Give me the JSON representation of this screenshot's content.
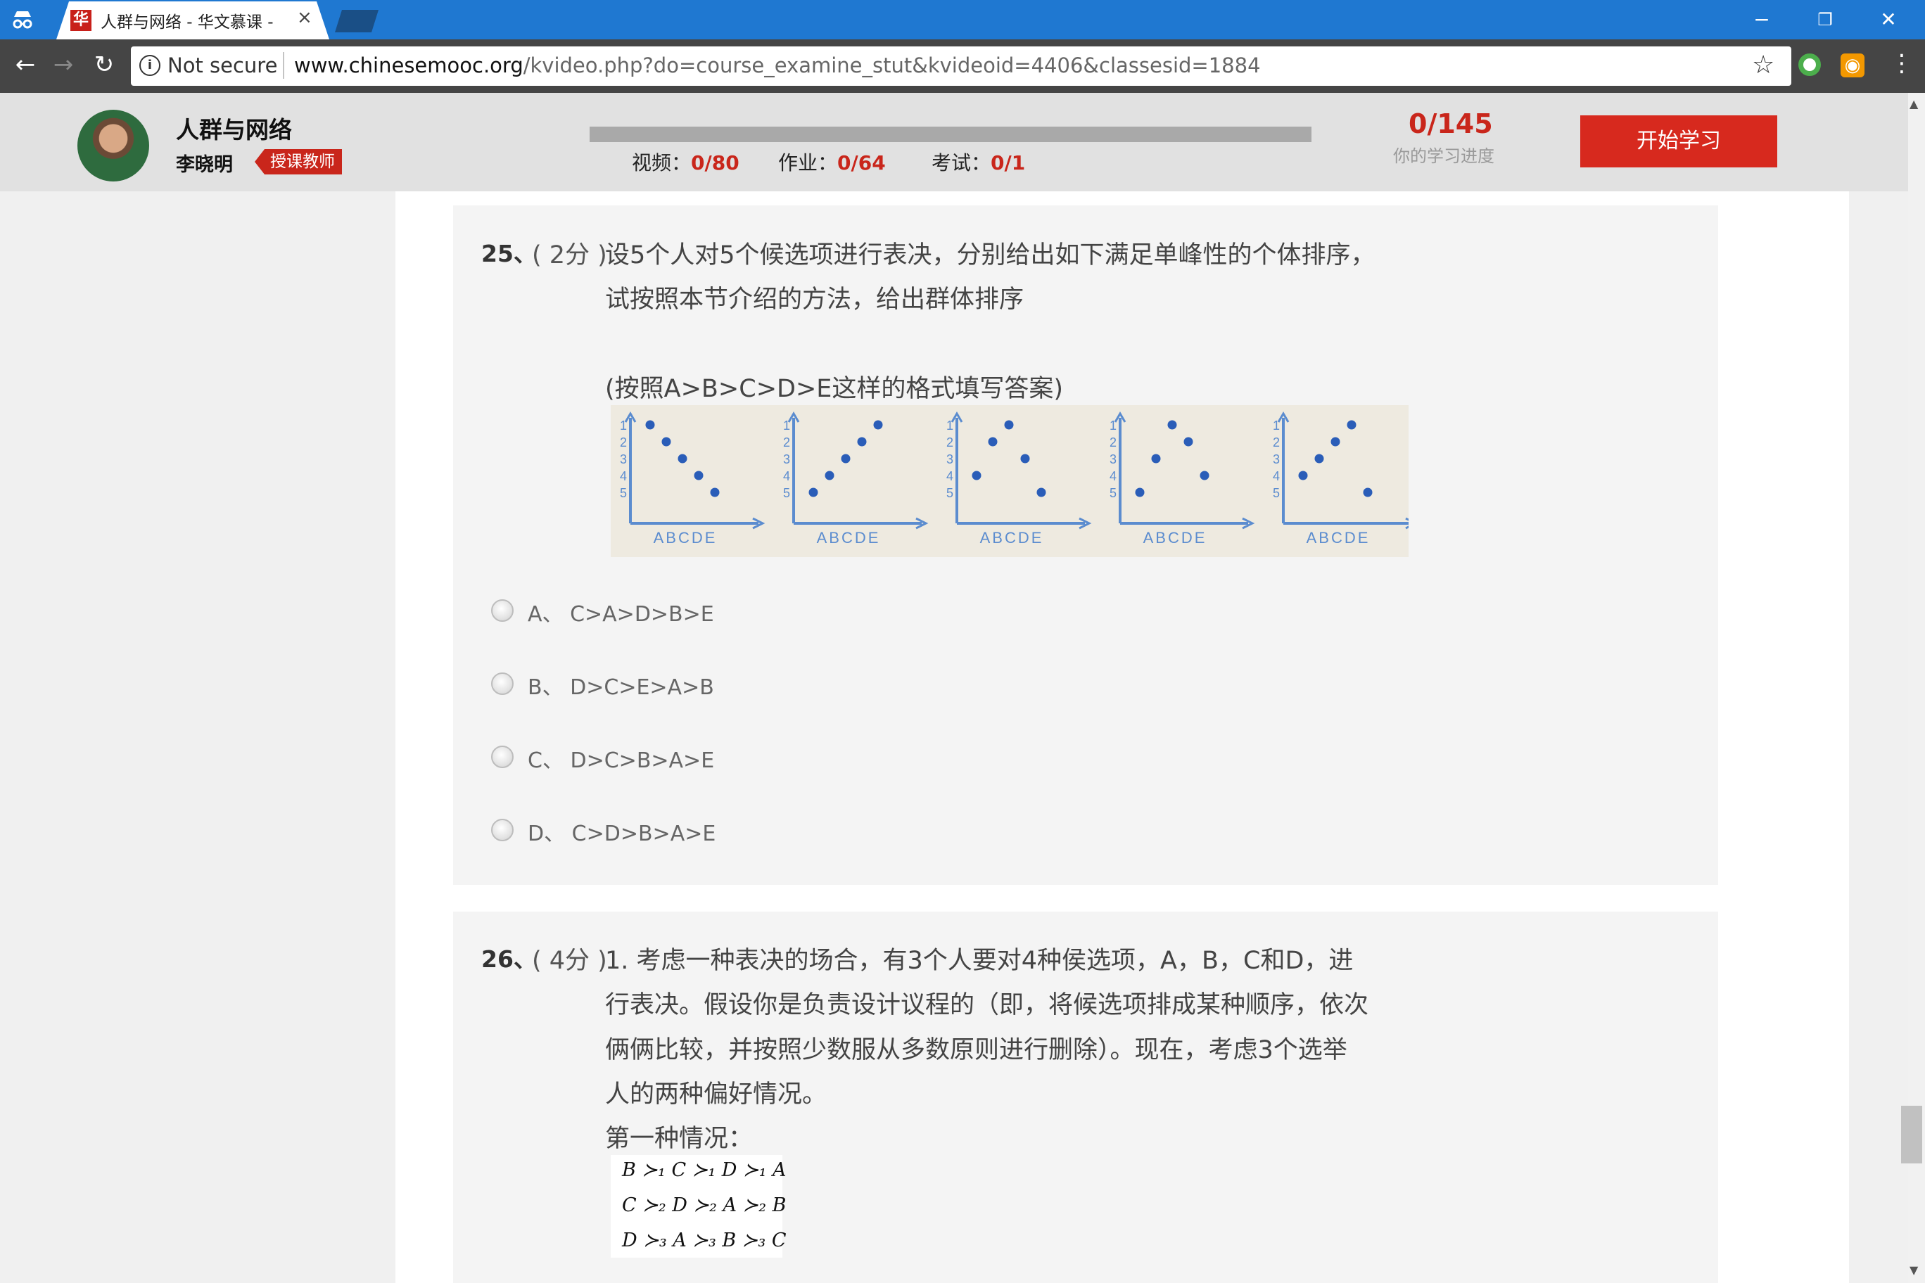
{
  "browser": {
    "tab_title": "人群与网络 - 华文慕课 -",
    "tab_favicon_glyph": "华",
    "not_secure": "Not secure",
    "url_host": "www.chinesemooc.org",
    "url_path": "/kvideo.php?do=course_examine_stut&kvideoid=4406&classesid=1884"
  },
  "course": {
    "title": "人群与网络",
    "teacher": "李晓明",
    "teacher_badge": "授课教师",
    "stats": [
      {
        "label": "视频：",
        "value": "0/80"
      },
      {
        "label": "作业：",
        "value": "0/64"
      },
      {
        "label": "考试：",
        "value": "0/1"
      }
    ],
    "progress_fraction": 0,
    "progress_count": "0/145",
    "progress_caption": "你的学习进度",
    "start_button": "开始学习"
  },
  "questions": [
    {
      "number": "25、",
      "score": "( 2分 )",
      "lines": [
        "设5个人对5个候选项进行表决，分别给出如下满足单峰性的个体排序，",
        "试按照本节介绍的方法，给出群体排序",
        "(按照A>B>C>D>E这样的格式填写答案)"
      ],
      "figure": {
        "x_labels": [
          "A",
          "B",
          "C",
          "D",
          "E"
        ],
        "y_labels": [
          "1",
          "2",
          "3",
          "4",
          "5"
        ],
        "axis_caption": "ABCDE",
        "rankings": [
          [
            1,
            2,
            3,
            4,
            5
          ],
          [
            5,
            4,
            3,
            2,
            1
          ],
          [
            4,
            2,
            1,
            3,
            5
          ],
          [
            5,
            3,
            1,
            2,
            4
          ],
          [
            4,
            3,
            2,
            1,
            5
          ]
        ],
        "point_color": "#2a5db8",
        "axis_color": "#5b8ccf"
      },
      "options": [
        {
          "letter": "A、",
          "text": "C>A>D>B>E"
        },
        {
          "letter": "B、",
          "text": "D>C>E>A>B"
        },
        {
          "letter": "C、",
          "text": "D>C>B>A>E"
        },
        {
          "letter": "D、",
          "text": "C>D>B>A>E"
        }
      ]
    },
    {
      "number": "26、",
      "score": "( 4分 )",
      "lines": [
        "1.    考虑一种表决的场合，有3个人要对4种侯选项，A，B，C和D，进",
        "行表决。假设你是负责设计议程的（即，将候选项排成某种顺序，依次",
        "俩俩比较，并按照少数服从多数原则进行删除）。现在，考虑3个选举",
        "人的两种偏好情况。",
        "第一种情况："
      ],
      "formula_rows": [
        "B ≻₁ C ≻₁ D ≻₁ A",
        "C ≻₂ D ≻₂ A ≻₂ B",
        "D ≻₃ A ≻₃ B ≻₃ C"
      ]
    }
  ]
}
